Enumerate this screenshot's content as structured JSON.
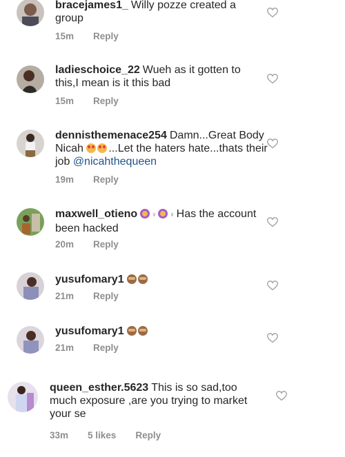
{
  "comments": [
    {
      "username": "bracejames1_",
      "text": "Willy pozze created a group",
      "time": "15m",
      "reply_label": "Reply"
    },
    {
      "username": "ladieschoice_22",
      "text": "Wueh as it gotten to this,I mean is it this bad",
      "time": "15m",
      "reply_label": "Reply"
    },
    {
      "username": "dennisthemenace254",
      "text_before": "Damn...Great Body Nicah",
      "text_after": "...Let the haters hate...thats their job",
      "mention": "@nicahthequeen",
      "time": "19m",
      "reply_label": "Reply"
    },
    {
      "username": "maxwell_otieno",
      "text": "Has the account  been hacked",
      "time": "20m",
      "reply_label": "Reply"
    },
    {
      "username": "yusufomary1",
      "time": "21m",
      "reply_label": "Reply"
    },
    {
      "username": "yusufomary1",
      "time": "21m",
      "reply_label": "Reply"
    },
    {
      "username": "queen_esther.5623",
      "text": "This is so sad,too much exposure ,are you trying to market your se",
      "time": "33m",
      "likes": "5 likes",
      "reply_label": "Reply"
    }
  ],
  "icons": {
    "like": "heart-outline-icon",
    "heart_eyes": "smiling-face-with-heart-eyes-emoji",
    "monkey": "see-no-evil-monkey-emoji",
    "woman": "woman-emoji"
  },
  "colors": {
    "text": "#262626",
    "meta": "#8e8e8e",
    "mention": "#21538a",
    "heart": "#9e9e9e"
  }
}
